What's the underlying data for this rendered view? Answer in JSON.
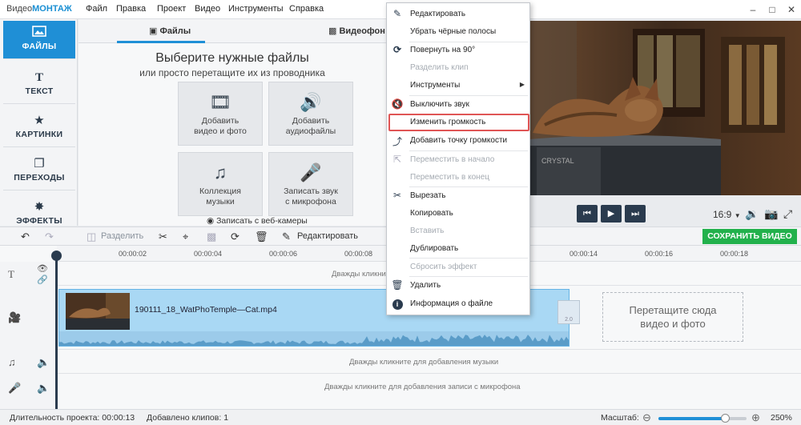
{
  "app": {
    "title_prefix": "Видео",
    "title_brand": "МОНТАЖ"
  },
  "menu": [
    "Файл",
    "Правка",
    "Проект",
    "Видео",
    "Инструменты",
    "Справка"
  ],
  "sidebar": {
    "items": [
      {
        "label": "ФАЙЛЫ",
        "icon": "image-icon",
        "active": true
      },
      {
        "label": "ТЕКСТ",
        "icon": "text-icon"
      },
      {
        "label": "КАРТИНКИ",
        "icon": "star-icon"
      },
      {
        "label": "ПЕРЕХОДЫ",
        "icon": "transitions-icon"
      },
      {
        "label": "ЭФФЕКТЫ",
        "icon": "magic-wand-icon"
      }
    ]
  },
  "files_panel": {
    "tabs": [
      "Файлы",
      "Видеофон"
    ],
    "heading": "Выберите нужные файлы",
    "subheading": "или просто перетащите их из проводника",
    "tiles": [
      {
        "label": "Добавить\nвидео и фото",
        "icon": "film-icon"
      },
      {
        "label": "Добавить\nаудиофайлы",
        "icon": "audio-file-icon"
      },
      {
        "label": "Коллекция\nмузыки",
        "icon": "music-notes-icon"
      },
      {
        "label": "Записать звук\nс микрофона",
        "icon": "microphone-icon"
      }
    ],
    "webcam": "Записать с веб-камеры"
  },
  "player": {
    "aspect": "16:9"
  },
  "toolbar": {
    "split": "Разделить",
    "edit": "Редактировать",
    "save": "СОХРАНИТЬ ВИДЕО"
  },
  "ruler": [
    "00:00:02",
    "00:00:04",
    "00:00:06",
    "00:00:08",
    "00:00:14",
    "00:00:16",
    "00:00:18"
  ],
  "timeline": {
    "text_hint": "Дважды кликните для добавления текста",
    "clip_name": "190111_18_WatPhoTemple—Cat.mp4",
    "dropzone": "Перетащите сюда\nвидео и фото",
    "transition_label": "2.0",
    "music_hint": "Дважды кликните для добавления музыки",
    "mic_hint": "Дважды кликните для добавления записи с микрофона"
  },
  "status": {
    "duration_label": "Длительность проекта:",
    "duration": "00:00:13",
    "clips_label": "Добавлено клипов:",
    "clips": "1",
    "zoom_label": "Масштаб:",
    "zoom": "250%",
    "zoom_fraction": 0.75
  },
  "context_menu": {
    "items": [
      {
        "label": "Редактировать",
        "icon": "pencil-icon"
      },
      {
        "label": "Убрать чёрные полосы"
      },
      {
        "label": "Повернуть на 90°",
        "icon": "rotate-icon"
      },
      {
        "label": "Разделить клип",
        "disabled": true
      },
      {
        "label": "Инструменты",
        "submenu": true
      },
      {
        "label": "Выключить звук",
        "icon": "mute-icon"
      },
      {
        "label": "Изменить громкость",
        "highlighted": true
      },
      {
        "label": "Добавить точку громкости",
        "icon": "volume-point-icon"
      },
      {
        "label": "Переместить в начало",
        "icon": "move-icon",
        "disabled": true
      },
      {
        "label": "Переместить в конец",
        "disabled": true
      },
      {
        "label": "Вырезать",
        "icon": "scissors-icon"
      },
      {
        "label": "Копировать"
      },
      {
        "label": "Вставить",
        "disabled": true
      },
      {
        "label": "Дублировать"
      },
      {
        "label": "Сбросить эффект",
        "disabled": true
      },
      {
        "label": "Удалить",
        "icon": "trash-icon"
      },
      {
        "label": "Информация о файле",
        "icon": "info-icon"
      }
    ]
  },
  "colors": {
    "accent": "#1f8fd6",
    "save": "#22b14c",
    "highlight_border": "#e05555"
  }
}
